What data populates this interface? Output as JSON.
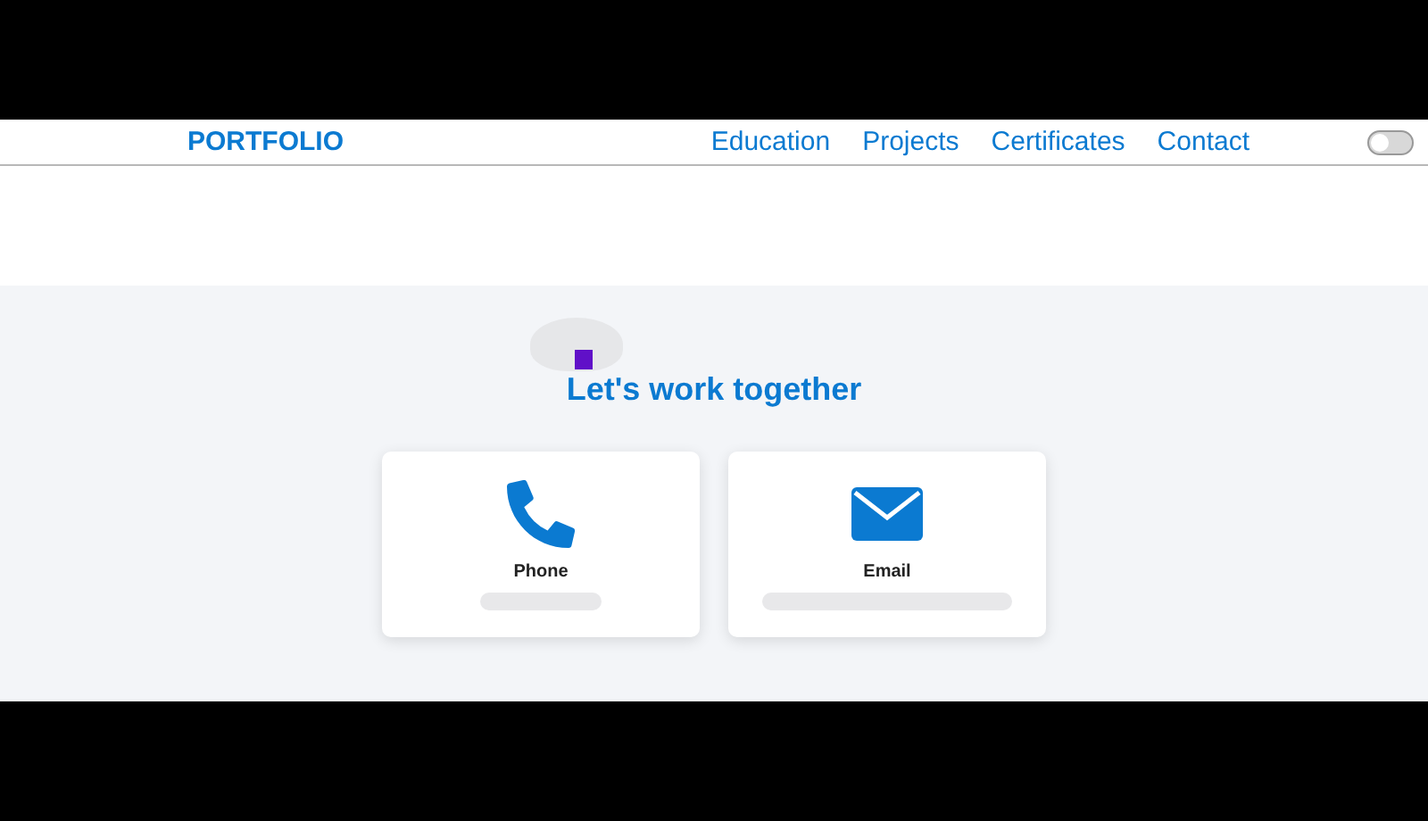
{
  "brand": "PORTFOLIO",
  "nav": [
    {
      "label": "Education"
    },
    {
      "label": "Projects"
    },
    {
      "label": "Certificates"
    },
    {
      "label": "Contact"
    }
  ],
  "theme_toggle": {
    "on": false
  },
  "contact": {
    "title": "Let's work together",
    "cards": [
      {
        "kind": "phone",
        "label": "Phone"
      },
      {
        "kind": "email",
        "label": "Email"
      }
    ]
  }
}
